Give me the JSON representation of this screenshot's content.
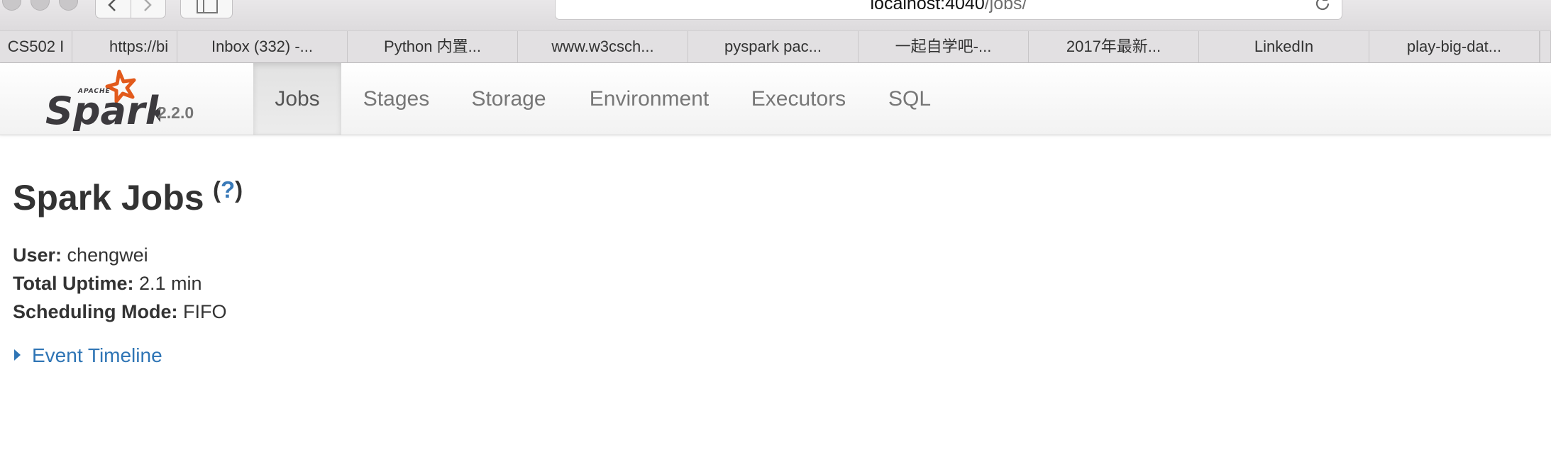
{
  "browser": {
    "address": {
      "host": "localhost:4040",
      "path": "/jobs/"
    },
    "bookmarks": [
      "CS502 I",
      "https://bi",
      "Inbox (332) -...",
      "Python 内置...",
      "www.w3csch...",
      "pyspark pac...",
      "一起自学吧-...",
      "2017年最新...",
      "LinkedIn",
      "play-big-dat..."
    ]
  },
  "navbar": {
    "brand_apache": "APACHE",
    "brand_name": "Spark",
    "version": "2.2.0",
    "tabs": [
      "Jobs",
      "Stages",
      "Storage",
      "Environment",
      "Executors",
      "SQL"
    ],
    "active_tab": "Jobs"
  },
  "page": {
    "title": "Spark Jobs",
    "help": {
      "open": "(",
      "q": "?",
      "close": ")"
    },
    "info": {
      "user_label": "User:",
      "user_value": "chengwei",
      "uptime_label": "Total Uptime:",
      "uptime_value": "2.1 min",
      "sched_label": "Scheduling Mode:",
      "sched_value": "FIFO"
    },
    "timeline_label": "Event Timeline"
  },
  "colors": {
    "link": "#2f75b5",
    "spark_orange": "#e25a1c",
    "spark_text": "#3c3a3e"
  }
}
